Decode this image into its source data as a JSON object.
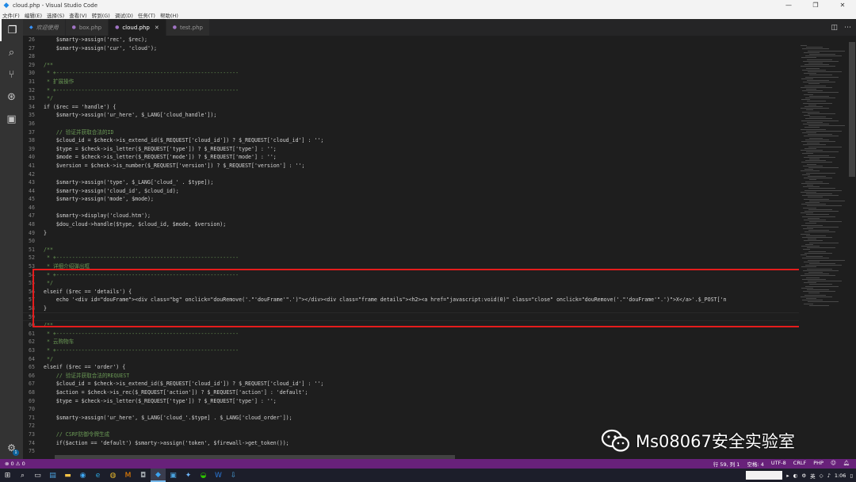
{
  "window": {
    "title": "cloud.php - Visual Studio Code"
  },
  "menu": [
    "文件(F)",
    "编辑(E)",
    "选择(S)",
    "查看(V)",
    "转到(G)",
    "调试(D)",
    "任务(T)",
    "帮助(H)"
  ],
  "tabs": [
    {
      "label": "欢迎使用",
      "italic": true
    },
    {
      "label": "box.php"
    },
    {
      "label": "cloud.php",
      "active": true
    },
    {
      "label": "test.php"
    }
  ],
  "code": [
    {
      "n": "26",
      "t": "    $smarty->assign('rec', $rec);"
    },
    {
      "n": "27",
      "t": "    $smarty->assign('cur', 'cloud');"
    },
    {
      "n": "28",
      "t": ""
    },
    {
      "n": "29",
      "t": "/**"
    },
    {
      "n": "30",
      "t": " * +----------------------------------------------------------"
    },
    {
      "n": "31",
      "t": " * 扩展操作"
    },
    {
      "n": "32",
      "t": " * +----------------------------------------------------------"
    },
    {
      "n": "33",
      "t": " */"
    },
    {
      "n": "34",
      "t": "if ($rec == 'handle') {"
    },
    {
      "n": "35",
      "t": "    $smarty->assign('ur_here', $_LANG['cloud_handle']);"
    },
    {
      "n": "36",
      "t": ""
    },
    {
      "n": "37",
      "t": "    // 验证并获取合法的ID"
    },
    {
      "n": "38",
      "t": "    $cloud_id = $check->is_extend_id($_REQUEST['cloud_id']) ? $_REQUEST['cloud_id'] : '';"
    },
    {
      "n": "39",
      "t": "    $type = $check->is_letter($_REQUEST['type']) ? $_REQUEST['type'] : '';"
    },
    {
      "n": "40",
      "t": "    $mode = $check->is_letter($_REQUEST['mode']) ? $_REQUEST['mode'] : '';"
    },
    {
      "n": "41",
      "t": "    $version = $check->is_number($_REQUEST['version']) ? $_REQUEST['version'] : '';"
    },
    {
      "n": "42",
      "t": ""
    },
    {
      "n": "43",
      "t": "    $smarty->assign('type', $_LANG['cloud_' . $type]);"
    },
    {
      "n": "44",
      "t": "    $smarty->assign('cloud_id', $cloud_id);"
    },
    {
      "n": "45",
      "t": "    $smarty->assign('mode', $mode);"
    },
    {
      "n": "46",
      "t": ""
    },
    {
      "n": "47",
      "t": "    $smarty->display('cloud.htm');"
    },
    {
      "n": "48",
      "t": "    $dou_cloud->handle($type, $cloud_id, $mode, $version);"
    },
    {
      "n": "49",
      "t": "}"
    },
    {
      "n": "50",
      "t": ""
    },
    {
      "n": "51",
      "t": "/**"
    },
    {
      "n": "52",
      "t": " * +----------------------------------------------------------"
    },
    {
      "n": "53",
      "t": " * 详细介绍弹出框"
    },
    {
      "n": "54",
      "t": " * +----------------------------------------------------------"
    },
    {
      "n": "55",
      "t": " */"
    },
    {
      "n": "56",
      "t": "elseif ($rec == 'details') {"
    },
    {
      "n": "57",
      "t": "    echo '<div id=\"douFrame\"><div class=\"bg\" onclick=\"douRemove('.\"'douFrame'\".')\"></div><div class=\"frame details\"><h2><a href=\"javascript:void(0)\" class=\"close\" onclick=\"douRemove('.\"'douFrame'\".')\">X</a>'.$_POST['n"
    },
    {
      "n": "58",
      "t": "}"
    },
    {
      "n": "59",
      "t": ""
    },
    {
      "n": "60",
      "t": "/**"
    },
    {
      "n": "61",
      "t": " * +----------------------------------------------------------"
    },
    {
      "n": "62",
      "t": " * 云购物车"
    },
    {
      "n": "63",
      "t": " * +----------------------------------------------------------"
    },
    {
      "n": "64",
      "t": " */"
    },
    {
      "n": "65",
      "t": "elseif ($rec == 'order') {"
    },
    {
      "n": "66",
      "t": "    // 验证并获取合法的REQUEST"
    },
    {
      "n": "67",
      "t": "    $cloud_id = $check->is_extend_id($_REQUEST['cloud_id']) ? $_REQUEST['cloud_id'] : '';"
    },
    {
      "n": "68",
      "t": "    $action = $check->is_rec($_REQUEST['action']) ? $_REQUEST['action'] : 'default';"
    },
    {
      "n": "69",
      "t": "    $type = $check->is_letter($_REQUEST['type']) ? $_REQUEST['type'] : '';"
    },
    {
      "n": "70",
      "t": ""
    },
    {
      "n": "71",
      "t": "    $smarty->assign('ur_here', $_LANG['cloud_'.$type] . $_LANG['cloud_order']);"
    },
    {
      "n": "72",
      "t": ""
    },
    {
      "n": "73",
      "t": "    // CSRF防御令牌生成"
    },
    {
      "n": "74",
      "t": "    if($action == 'default') $smarty->assign('token', $firewall->get_token());"
    },
    {
      "n": "75",
      "t": ""
    }
  ],
  "status": {
    "problems": "⊗ 0 ⚠ 0",
    "position": "行 59, 列 1",
    "spaces": "空格: 4",
    "encoding": "UTF-8",
    "eol": "CRLF",
    "language": "PHP"
  },
  "taskbar": {
    "ime": "英",
    "time": "1:06"
  },
  "watermark": "Ms08067安全实验室"
}
